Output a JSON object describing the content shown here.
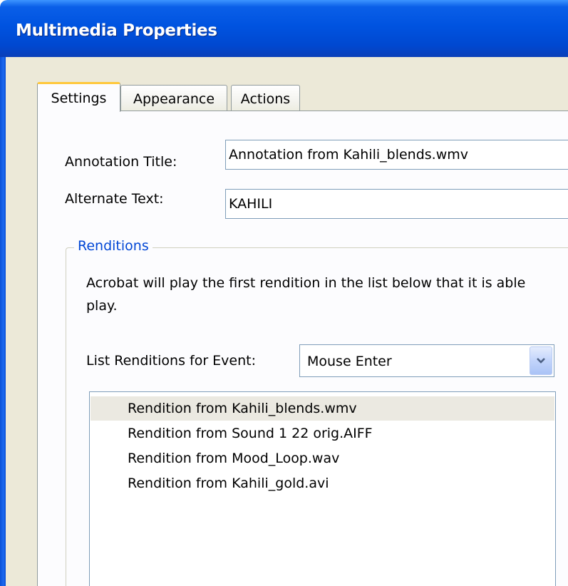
{
  "window": {
    "title": "Multimedia Properties"
  },
  "tabs": [
    {
      "label": "Settings",
      "active": true
    },
    {
      "label": "Appearance",
      "active": false
    },
    {
      "label": "Actions",
      "active": false
    }
  ],
  "settings": {
    "annotation_title_label": "Annotation Title:",
    "annotation_title_value": "Annotation from Kahili_blends.wmv",
    "alternate_text_label": "Alternate Text:",
    "alternate_text_value": "KAHILI",
    "renditions": {
      "legend": "Renditions",
      "description_line1": "Acrobat will play the first rendition in the list below that it is able",
      "description_line2": "play.",
      "event_label": "List Renditions for Event:",
      "event_selected": "Mouse Enter",
      "items": [
        {
          "label": "Rendition from Kahili_blends.wmv",
          "selected": true
        },
        {
          "label": "Rendition from Sound 1 22 orig.AIFF",
          "selected": false
        },
        {
          "label": "Rendition from Mood_Loop.wav",
          "selected": false
        },
        {
          "label": "Rendition from Kahili_gold.avi",
          "selected": false
        }
      ]
    }
  },
  "icons": {
    "dropdown": "chevron-down-icon"
  },
  "colors": {
    "titlebar": "#0053e0",
    "dialog_bg": "#ece9d8",
    "active_tab_accent": "#ffc83c",
    "group_legend": "#0046d5",
    "selected_row": "#ebe9e1"
  }
}
